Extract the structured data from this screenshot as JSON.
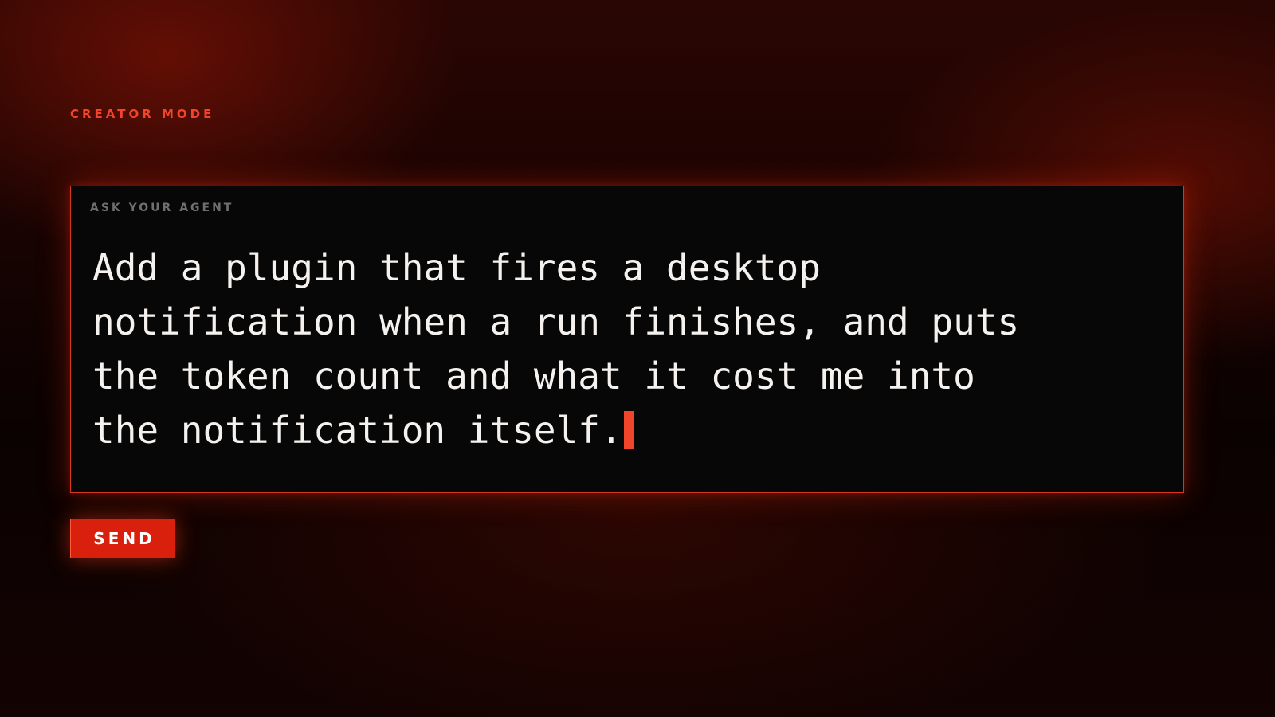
{
  "header": {
    "mode_label": "CREATOR MODE"
  },
  "prompt": {
    "field_label": "ASK YOUR AGENT",
    "text": "Add a plugin that fires a desktop notification when a run finishes, and puts the token count and what it cost me into the notification itself.",
    "cursor_visible": true
  },
  "actions": {
    "send_label": "SEND"
  },
  "colors": {
    "accent": "#f0452a",
    "button": "#d9200c",
    "panel": "#070707",
    "text": "#f4f1ee",
    "muted_label": "#6f6f6f"
  }
}
